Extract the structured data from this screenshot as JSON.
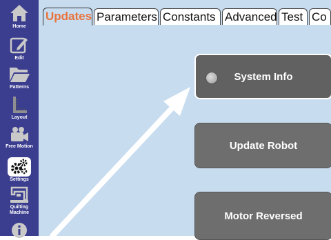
{
  "sidebar": {
    "items": [
      {
        "label": "Home",
        "icon": "home-icon"
      },
      {
        "label": "Edit",
        "icon": "edit-icon"
      },
      {
        "label": "Patterns",
        "icon": "folder-icon"
      },
      {
        "label": "Layout",
        "icon": "ruler-icon"
      },
      {
        "label": "Free Motion",
        "icon": "video-camera-icon"
      },
      {
        "label": "Settings",
        "icon": "gears-icon"
      },
      {
        "label": "Quilting Machine",
        "icon": "sewing-machine-icon"
      },
      {
        "label": "",
        "icon": "info-icon"
      }
    ],
    "active": "Settings"
  },
  "tabs": [
    {
      "label": "Updates"
    },
    {
      "label": "Parameters"
    },
    {
      "label": "Constants"
    },
    {
      "label": "Advanced"
    },
    {
      "label": "Test"
    },
    {
      "label": "Co"
    }
  ],
  "active_tab": "Updates",
  "cards": [
    {
      "label": "System Info"
    },
    {
      "label": "Update Robot"
    },
    {
      "label": "Motor Reversed"
    }
  ],
  "colors": {
    "sidebar": "#3b3d8f",
    "content_bg": "#c8dcef",
    "active_tab_text": "#e8733c",
    "card_bg": "#6e6e6e"
  }
}
